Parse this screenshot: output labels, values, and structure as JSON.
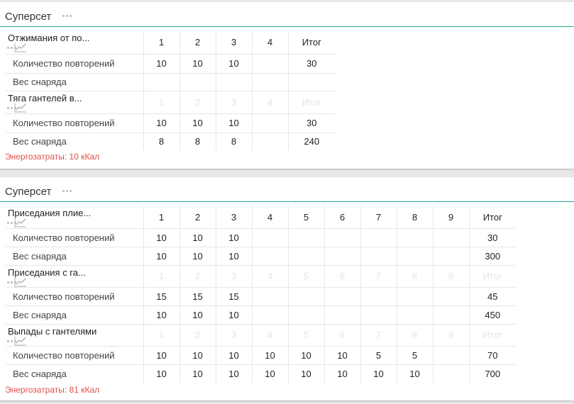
{
  "supersets": [
    {
      "title": "Суперсет",
      "headers": [
        "1",
        "2",
        "3",
        "4",
        "Итог"
      ],
      "exercises": [
        {
          "name": "Отжимания от по...",
          "rows": [
            {
              "label": "Количество повторений",
              "values": [
                "10",
                "10",
                "10",
                "",
                "30"
              ]
            },
            {
              "label": "Вес снаряда",
              "values": [
                "",
                "",
                "",
                "",
                ""
              ]
            }
          ]
        },
        {
          "name": "Тяга гантелей в...",
          "rows": [
            {
              "label": "Количество повторений",
              "values": [
                "10",
                "10",
                "10",
                "",
                "30"
              ]
            },
            {
              "label": "Вес снаряда",
              "values": [
                "8",
                "8",
                "8",
                "",
                "240"
              ]
            }
          ]
        }
      ],
      "energy": "Энергозатраты: 10 кКал"
    },
    {
      "title": "Суперсет",
      "headers": [
        "1",
        "2",
        "3",
        "4",
        "5",
        "6",
        "7",
        "8",
        "9",
        "Итог"
      ],
      "exercises": [
        {
          "name": "Приседания плие...",
          "rows": [
            {
              "label": "Количество повторений",
              "values": [
                "10",
                "10",
                "10",
                "",
                "",
                "",
                "",
                "",
                "",
                "30"
              ]
            },
            {
              "label": "Вес снаряда",
              "values": [
                "10",
                "10",
                "10",
                "",
                "",
                "",
                "",
                "",
                "",
                "300"
              ]
            }
          ]
        },
        {
          "name": "Приседания с га...",
          "rows": [
            {
              "label": "Количество повторений",
              "values": [
                "15",
                "15",
                "15",
                "",
                "",
                "",
                "",
                "",
                "",
                "45"
              ]
            },
            {
              "label": "Вес снаряда",
              "values": [
                "10",
                "10",
                "10",
                "",
                "",
                "",
                "",
                "",
                "",
                "450"
              ]
            }
          ]
        },
        {
          "name": "Выпады с гантелями",
          "rows": [
            {
              "label": "Количество повторений",
              "values": [
                "10",
                "10",
                "10",
                "10",
                "10",
                "10",
                "5",
                "5",
                "",
                "70"
              ]
            },
            {
              "label": "Вес снаряда",
              "values": [
                "10",
                "10",
                "10",
                "10",
                "10",
                "10",
                "10",
                "10",
                "",
                "700"
              ]
            }
          ]
        }
      ],
      "energy": "Энергозатраты: 81 кКал"
    }
  ]
}
